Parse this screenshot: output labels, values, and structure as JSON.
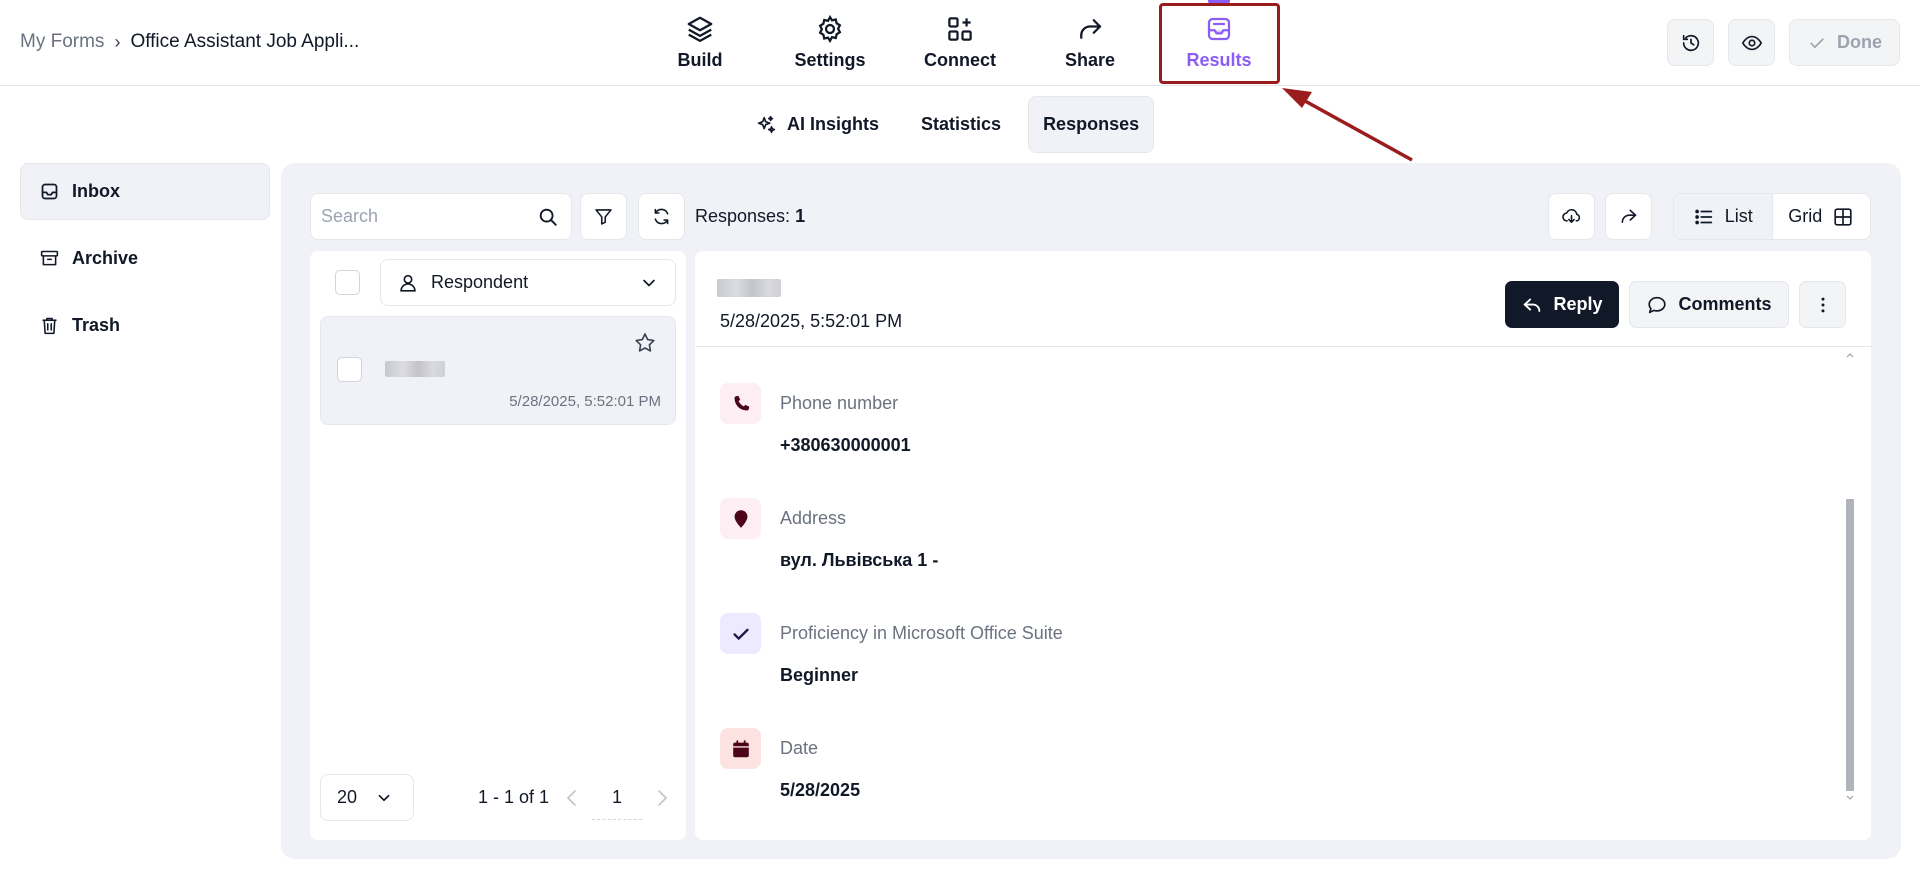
{
  "breadcrumb": {
    "root": "My Forms",
    "separator": "›",
    "current": "Office Assistant Job Appli..."
  },
  "nav": [
    {
      "label": "Build",
      "icon": "layers-icon"
    },
    {
      "label": "Settings",
      "icon": "gear-icon"
    },
    {
      "label": "Connect",
      "icon": "apps-plus-icon"
    },
    {
      "label": "Share",
      "icon": "share-arrow-icon"
    },
    {
      "label": "Results",
      "icon": "inbox-icon",
      "active": true
    }
  ],
  "top_actions": {
    "done_label": "Done"
  },
  "subtabs": [
    {
      "label": "AI Insights",
      "icon": "sparkles-icon"
    },
    {
      "label": "Statistics"
    },
    {
      "label": "Responses",
      "active": true
    }
  ],
  "sidebar": [
    {
      "label": "Inbox",
      "icon": "inbox-icon",
      "active": true
    },
    {
      "label": "Archive",
      "icon": "archive-icon"
    },
    {
      "label": "Trash",
      "icon": "trash-icon"
    }
  ],
  "toolbar": {
    "search_placeholder": "Search",
    "responses_label": "Responses:",
    "responses_count": "1",
    "view_list": "List",
    "view_grid": "Grid"
  },
  "list": {
    "filter_label": "Respondent",
    "items": [
      {
        "date": "5/28/2025, 5:52:01 PM"
      }
    ],
    "page_size": "20",
    "range": "1 - 1 of 1",
    "page": "1"
  },
  "detail": {
    "date": "5/28/2025, 5:52:01 PM",
    "reply_label": "Reply",
    "comments_label": "Comments",
    "fields": [
      {
        "label": "Phone number",
        "value": "+380630000001",
        "icon": "phone-icon",
        "bg": "#fdeef3",
        "color": "#4c0519"
      },
      {
        "label": "Address",
        "value": "вул. Львівська 1 -",
        "icon": "map-pin-icon",
        "bg": "#fdeef3",
        "color": "#4c0519"
      },
      {
        "label": "Proficiency in Microsoft Office Suite",
        "value": "Beginner",
        "icon": "check-icon",
        "bg": "#ede9fe",
        "color": "#1e1b4b"
      },
      {
        "label": "Date",
        "value": "5/28/2025",
        "icon": "calendar-icon",
        "bg": "#fde2e2",
        "color": "#4c0519"
      }
    ]
  },
  "colors": {
    "accent": "#8b5cf6",
    "annotation": "#9b1c1c",
    "panel_bg": "#f1f2f7",
    "dark_button": "#111827"
  }
}
